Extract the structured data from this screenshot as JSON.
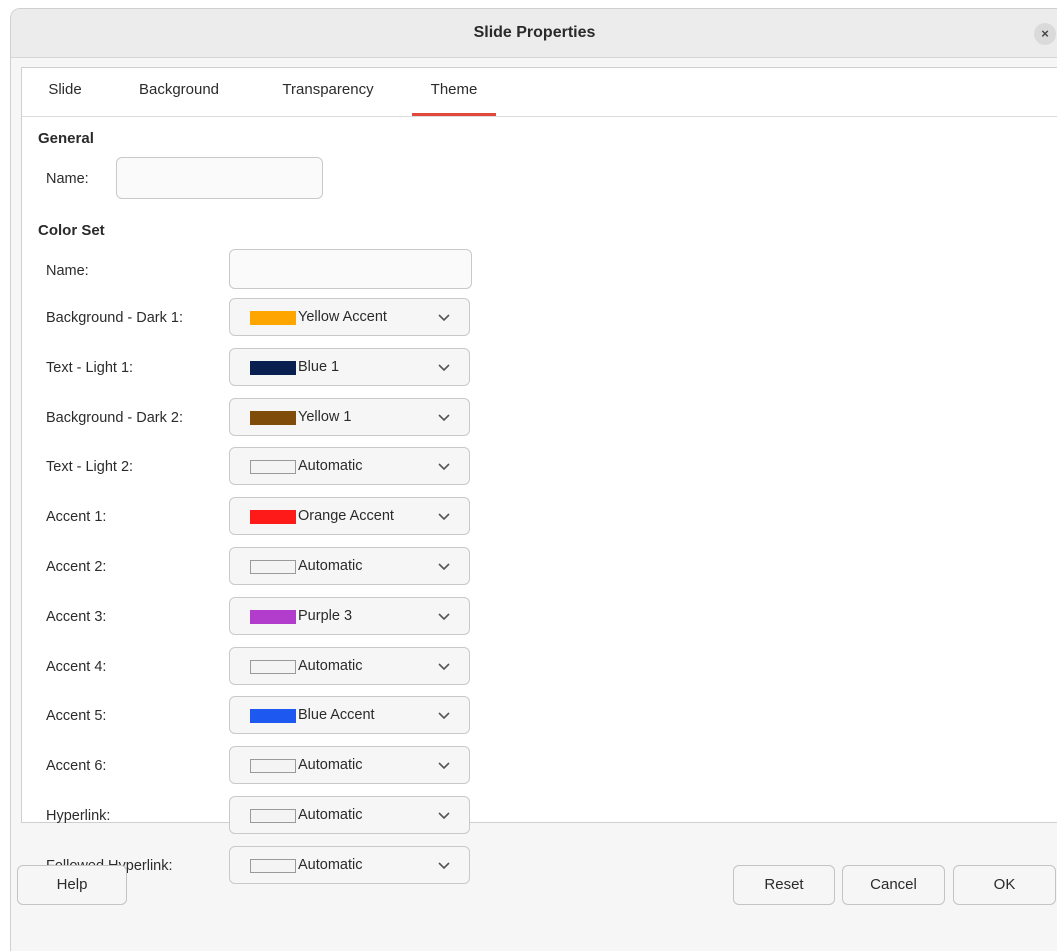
{
  "dialog": {
    "title": "Slide Properties",
    "close_label": "×"
  },
  "tabs": [
    {
      "label": "Slide"
    },
    {
      "label": "Background"
    },
    {
      "label": "Transparency"
    },
    {
      "label": "Theme",
      "active": true
    }
  ],
  "general": {
    "heading": "General",
    "name_label": "Name:",
    "name_value": ""
  },
  "color_set": {
    "heading": "Color Set",
    "name_label": "Name:",
    "name_value": "",
    "rows": [
      {
        "label": "Background - Dark 1:",
        "value": "Yellow Accent",
        "color": "#ffa500"
      },
      {
        "label": "Text - Light 1:",
        "value": "Blue 1",
        "color": "#081f4f"
      },
      {
        "label": "Background - Dark 2:",
        "value": "Yellow 1",
        "color": "#7f4c0a"
      },
      {
        "label": "Text - Light 2:",
        "value": "Automatic",
        "color": ""
      },
      {
        "label": "Accent 1:",
        "value": "Orange Accent",
        "color": "#ff1a1a"
      },
      {
        "label": "Accent 2:",
        "value": "Automatic",
        "color": ""
      },
      {
        "label": "Accent 3:",
        "value": "Purple 3",
        "color": "#b23ccc"
      },
      {
        "label": "Accent 4:",
        "value": "Automatic",
        "color": ""
      },
      {
        "label": "Accent 5:",
        "value": "Blue Accent",
        "color": "#1d59f0"
      },
      {
        "label": "Accent 6:",
        "value": "Automatic",
        "color": ""
      },
      {
        "label": "Hyperlink:",
        "value": "Automatic",
        "color": ""
      },
      {
        "label": "Followed Hyperlink:",
        "value": "Automatic",
        "color": ""
      }
    ]
  },
  "footer": {
    "help": "Help",
    "reset": "Reset",
    "cancel": "Cancel",
    "ok": "OK"
  },
  "accent_color": "#e0483c"
}
